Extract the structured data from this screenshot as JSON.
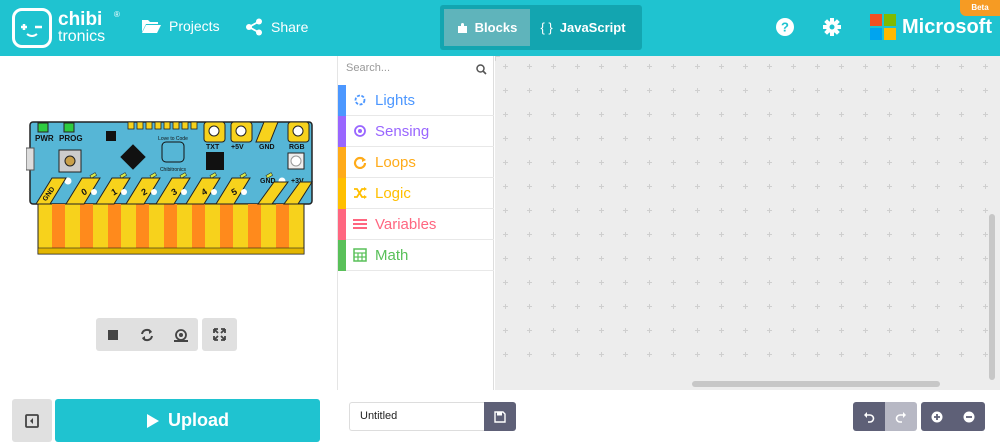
{
  "header": {
    "logo_line1": "chibi",
    "logo_line2": "tronics",
    "logo_reg": "®",
    "projects_label": "Projects",
    "share_label": "Share",
    "blocks_label": "Blocks",
    "javascript_label": "JavaScript",
    "js_braces": "{ }",
    "ms_name": "Microsoft",
    "beta_label": "Beta",
    "colors": {
      "bar": "#1fc3d0",
      "toggle_bg": "#13a5b0",
      "active_tab": "#5fb4bb"
    }
  },
  "board": {
    "pwr": "PWR",
    "prog": "PROG",
    "txt": "TXT",
    "plus5v": "+5V",
    "gnd": "GND",
    "rgb": "RGB",
    "gnd2": "GND",
    "plus3v": "+3V",
    "gnd_pad": "GND",
    "love": "Love to Code",
    "brand": "Chibitronics",
    "pins": [
      "0",
      "1",
      "2",
      "3",
      "4",
      "5"
    ]
  },
  "toolbox": {
    "search_placeholder": "Search...",
    "categories": [
      {
        "label": "Lights",
        "color": "#4c97ff",
        "icon": "sun-icon"
      },
      {
        "label": "Sensing",
        "color": "#9966ff",
        "icon": "target-icon"
      },
      {
        "label": "Loops",
        "color": "#ffab19",
        "icon": "loop-icon"
      },
      {
        "label": "Logic",
        "color": "#ffbf00",
        "icon": "shuffle-icon"
      },
      {
        "label": "Variables",
        "color": "#ff6680",
        "icon": "list-icon"
      },
      {
        "label": "Math",
        "color": "#59c059",
        "icon": "calculator-icon"
      }
    ]
  },
  "footer": {
    "upload_label": "Upload",
    "project_name": "Untitled"
  }
}
